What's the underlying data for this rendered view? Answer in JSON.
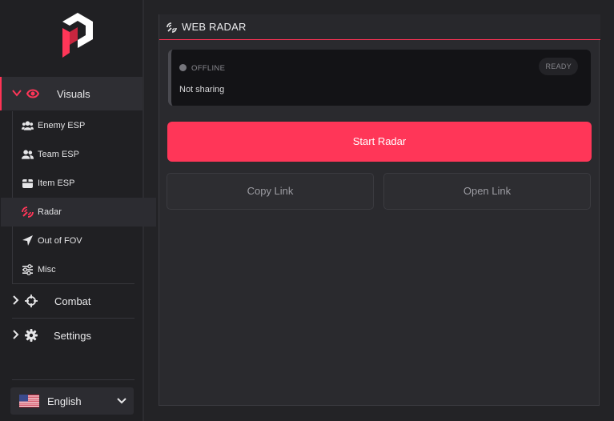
{
  "sidebar": {
    "nav": [
      {
        "label": "Visuals",
        "expanded": true
      },
      {
        "label": "Combat",
        "expanded": false
      },
      {
        "label": "Settings",
        "expanded": false
      }
    ],
    "subitems": [
      {
        "label": "Enemy ESP",
        "icon": "users-icon"
      },
      {
        "label": "Team ESP",
        "icon": "team-icon"
      },
      {
        "label": "Item ESP",
        "icon": "box-icon"
      },
      {
        "label": "Radar",
        "icon": "radar-icon",
        "active": true
      },
      {
        "label": "Out of FOV",
        "icon": "arrow-icon"
      },
      {
        "label": "Misc",
        "icon": "sliders-icon"
      }
    ],
    "language": {
      "label": "English",
      "flag": "us-flag-icon"
    }
  },
  "panel": {
    "title": "WEB RADAR",
    "status": {
      "state": "OFFLINE",
      "badge": "READY",
      "message": "Not sharing"
    },
    "start_button": "Start Radar",
    "copy_button": "Copy Link",
    "open_button": "Open Link"
  },
  "colors": {
    "accent": "#ff3658",
    "background": "#232326",
    "panel": "#2a2a2e"
  }
}
